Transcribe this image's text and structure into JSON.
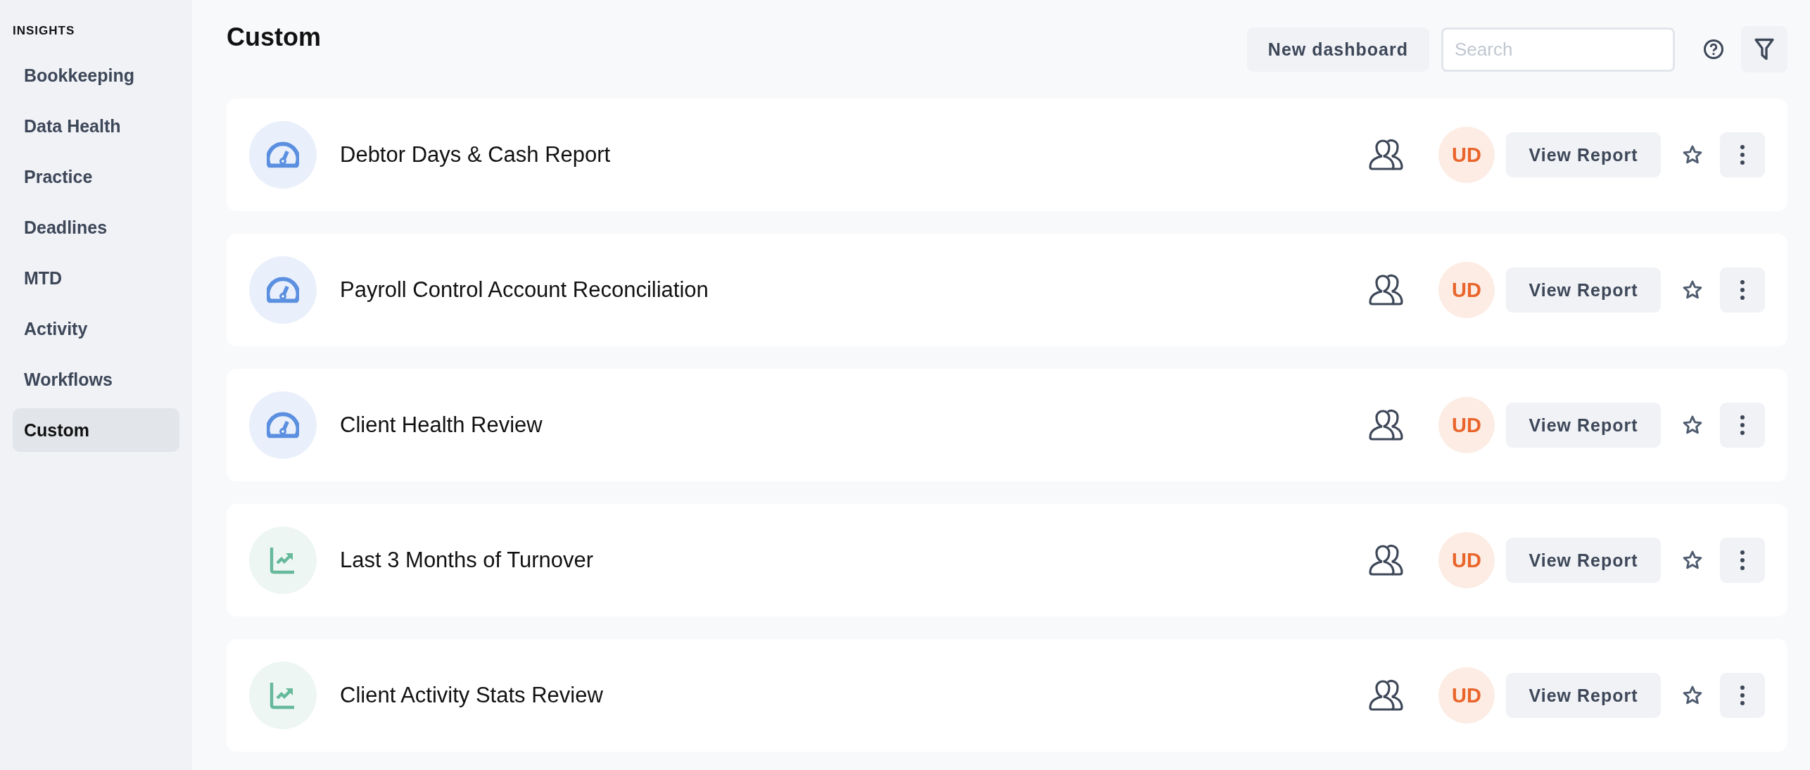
{
  "sidebar": {
    "heading": "INSIGHTS",
    "items": [
      {
        "label": "Bookkeeping",
        "selected": false
      },
      {
        "label": "Data Health",
        "selected": false
      },
      {
        "label": "Practice",
        "selected": false
      },
      {
        "label": "Deadlines",
        "selected": false
      },
      {
        "label": "MTD",
        "selected": false
      },
      {
        "label": "Activity",
        "selected": false
      },
      {
        "label": "Workflows",
        "selected": false
      },
      {
        "label": "Custom",
        "selected": true
      }
    ]
  },
  "header": {
    "title": "Custom",
    "new_button": "New dashboard",
    "search": {
      "placeholder": "Search"
    }
  },
  "dashboards": [
    {
      "kind": "gauge",
      "title": "Debtor Days & Cash Report",
      "owner": "UD",
      "action": "View Report"
    },
    {
      "kind": "gauge",
      "title": "Payroll Control Account Reconciliation",
      "owner": "UD",
      "action": "View Report"
    },
    {
      "kind": "gauge",
      "title": "Client Health Review",
      "owner": "UD",
      "action": "View Report"
    },
    {
      "kind": "chart",
      "title": "Last 3 Months of Turnover",
      "owner": "UD",
      "action": "View Report"
    },
    {
      "kind": "chart",
      "title": "Client Activity Stats Review",
      "owner": "UD",
      "action": "View Report"
    }
  ]
}
